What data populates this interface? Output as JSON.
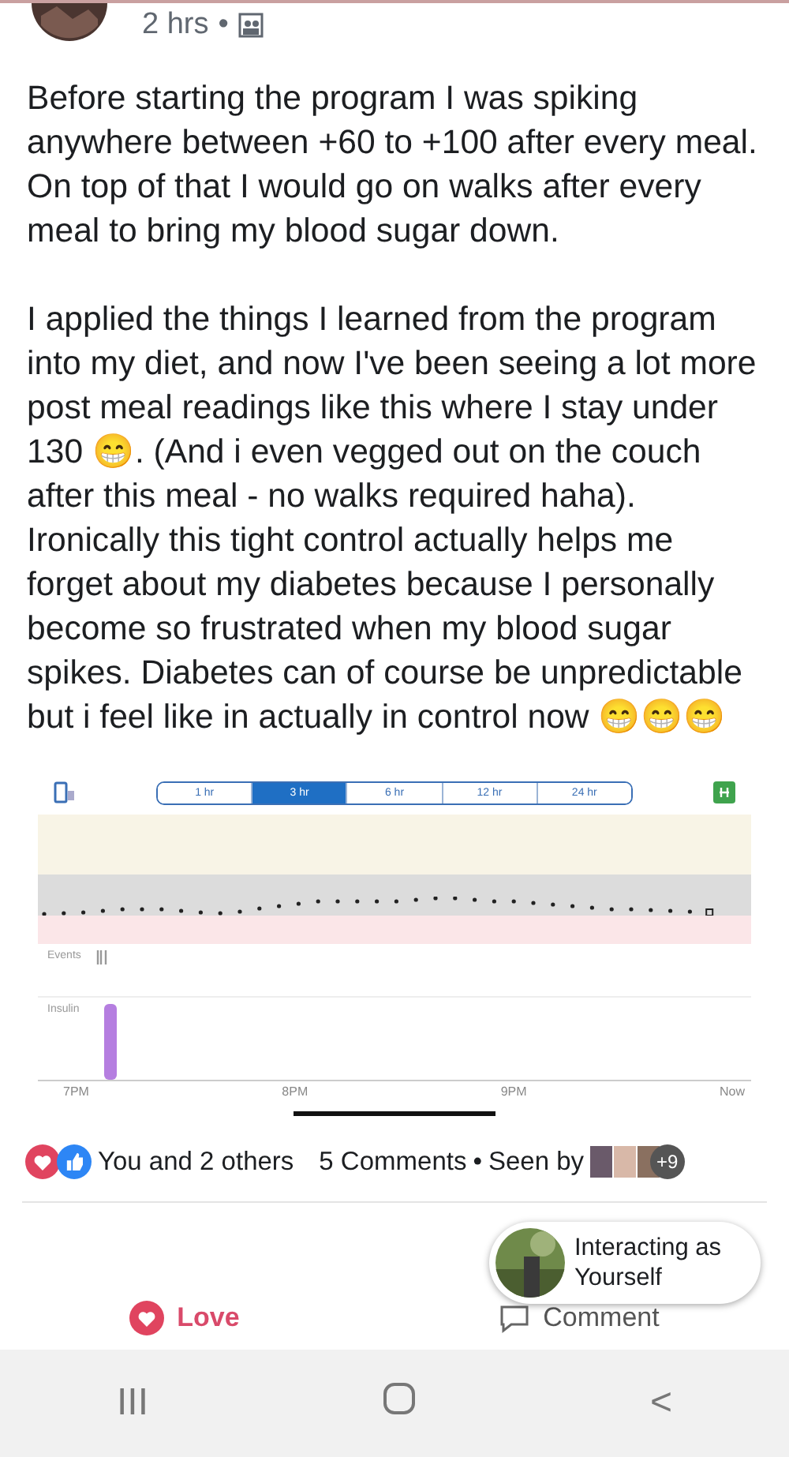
{
  "post_header": {
    "time": "2 hrs",
    "separator": "•"
  },
  "paragraphs": [
    "Before starting the program I was spiking anywhere between +60 to +100 after every meal. On top of that I would go on walks after every meal to bring my blood sugar down.",
    "I applied the things I learned from the program into my diet, and now I've been seeing a lot more post meal readings like this where I stay under 130 😁. (And i even vegged out on the couch after this meal - no walks required haha). Ironically this tight control actually helps me forget about my diabetes because I personally become so frustrated when my blood sugar spikes. Diabetes can of course be unpredictable but i feel like in actually in control now 😁😁😁"
  ],
  "glucose_screen": {
    "ranges": [
      {
        "label": "1 hr",
        "selected": false
      },
      {
        "label": "3 hr",
        "selected": true
      },
      {
        "label": "6 hr",
        "selected": false
      },
      {
        "label": "12 hr",
        "selected": false
      },
      {
        "label": "24 hr",
        "selected": false
      }
    ],
    "events_label": "Events",
    "insulin_label": "Insulin",
    "time_labels": [
      "7PM",
      "8PM",
      "9PM",
      "Now"
    ]
  },
  "reactions": {
    "summary": "You and 2 others",
    "comments": "5 Comments",
    "separator": "•",
    "seen_by": "Seen by",
    "seen_more": "+9"
  },
  "actions": [
    {
      "kind": "love",
      "label": "Love"
    },
    {
      "kind": "comment",
      "label": "Comment"
    }
  ],
  "tooltip": {
    "text": "Interacting as Yourself"
  },
  "nav_bar": {
    "buttons": [
      {
        "kind": "recents",
        "label": "III"
      },
      {
        "kind": "home"
      },
      {
        "kind": "back",
        "label": "<"
      }
    ]
  }
}
